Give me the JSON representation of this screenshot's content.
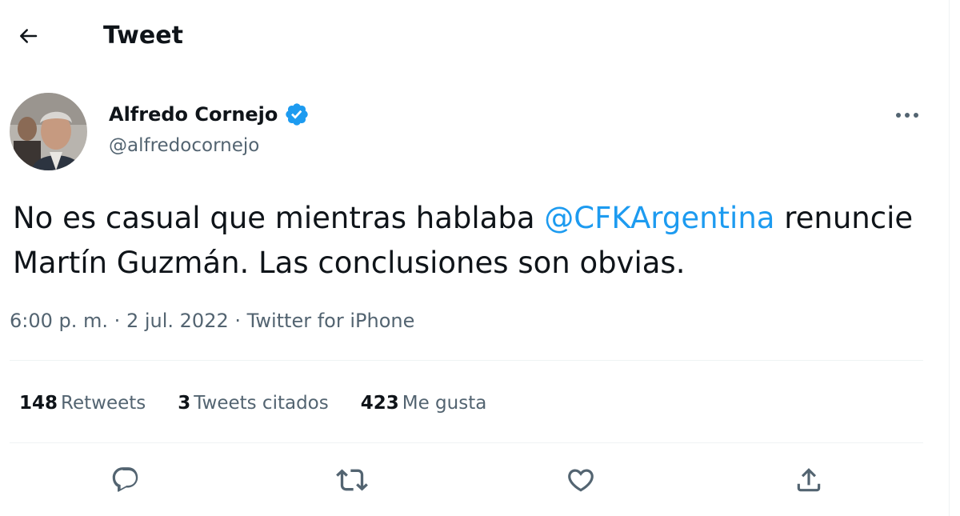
{
  "header": {
    "back_icon": "arrow-left-icon",
    "title": "Tweet"
  },
  "author": {
    "name": "Alfredo Cornejo",
    "handle": "@alfredocornejo",
    "verified_icon": "verified-badge-icon",
    "more_icon": "more-horizontal-icon"
  },
  "tweet": {
    "text_before": "No es casual que mientras hablaba ",
    "mention": "@CFKArgentina",
    "text_after": " renuncie Martín Guzmán. Las conclusiones son obvias."
  },
  "meta": {
    "time": "6:00 p. m.",
    "date": "2 jul. 2022",
    "separator": "·",
    "source": "Twitter for iPhone"
  },
  "stats": {
    "retweets_count": "148",
    "retweets_label": "Retweets",
    "quotes_count": "3",
    "quotes_label": "Tweets citados",
    "likes_count": "423",
    "likes_label": "Me gusta"
  },
  "actions": {
    "reply_icon": "reply-icon",
    "retweet_icon": "retweet-icon",
    "like_icon": "heart-icon",
    "share_icon": "share-icon"
  },
  "colors": {
    "accent": "#1d9bf0",
    "text": "#0f1419",
    "secondary": "#536471",
    "border": "#eff3f4"
  }
}
